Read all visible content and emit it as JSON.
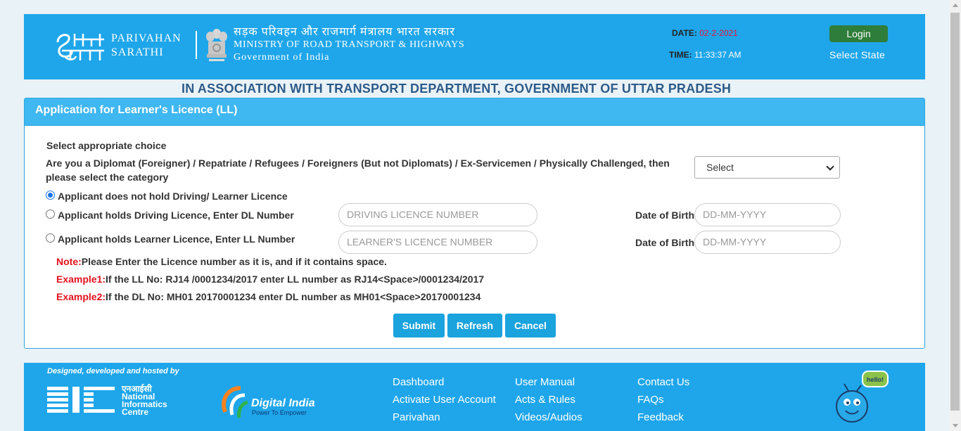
{
  "header": {
    "brand_line1": "PARIVAHAN",
    "brand_line2": "SARATHI",
    "ministry_hindi": "सड़क परिवहन और राजमार्ग मंत्रालय भारत सरकार",
    "ministry_english": "MINISTRY OF ROAD TRANSPORT & HIGHWAYS",
    "government": "Government of India",
    "date_label": "DATE:",
    "date_value": "02-2-2021",
    "time_label": "TIME:",
    "time_value": "11:33:37 AM",
    "login_label": "Login",
    "select_state_label": "Select State"
  },
  "association": "IN ASSOCIATION WITH TRANSPORT DEPARTMENT, GOVERNMENT OF UTTAR PRADESH",
  "form": {
    "title": "Application for Learner's Licence (LL)",
    "choice_heading": "Select appropriate choice",
    "category_question_line1": "Are you a Diplomat (Foreigner) / Repatriate / Refugees / Foreigners (But not Diplomats) / Ex-Servicemen / Physically Challenged, then",
    "category_question_line2": "please select the category",
    "category_selected": "Select",
    "option_no_licence": "Applicant does not hold Driving/ Learner Licence",
    "option_dl": "Applicant holds Driving Licence, Enter DL Number",
    "option_ll": "Applicant holds Learner Licence, Enter LL Number",
    "dl_placeholder": "DRIVING LICENCE NUMBER",
    "ll_placeholder": "LEARNER'S LICENCE NUMBER",
    "dob_label": "Date of Birth",
    "dob_placeholder": "DD-MM-YYYY",
    "note_label": "Note:",
    "note_text": "Please Enter the Licence number as it is, and if it contains space.",
    "example1_label": "Example1:",
    "example1_text": "If the LL No: RJ14 /0001234/2017 enter LL number as RJ14<Space>/0001234/2017",
    "example2_label": "Example2:",
    "example2_text": "If the DL No: MH01 20170001234 enter DL number as MH01<Space>20170001234",
    "submit_label": "Submit",
    "refresh_label": "Refresh",
    "cancel_label": "Cancel"
  },
  "footer": {
    "designed_text": "Designed, developed and hosted by",
    "nic_hindi": "एनआईसी",
    "nic_line1": "National",
    "nic_line2": "Informatics",
    "nic_line3": "Centre",
    "digital_india": "Digital India",
    "digital_india_tagline": "Power To Empower",
    "links_col1": [
      "Dashboard",
      "Activate User Account",
      "Parivahan"
    ],
    "links_col2": [
      "User Manual",
      "Acts & Rules",
      "Videos/Audios"
    ],
    "links_col3": [
      "Contact Us",
      "FAQs",
      "Feedback"
    ],
    "mascot_bubble": "hello!"
  },
  "colors": {
    "header_blue": "#1fa6ea",
    "panel_head": "#3fb7f0",
    "button_blue": "#1aa3dd",
    "login_green": "#2f7d3a",
    "note_red": "#e4111c",
    "date_red": "#e8113c"
  }
}
